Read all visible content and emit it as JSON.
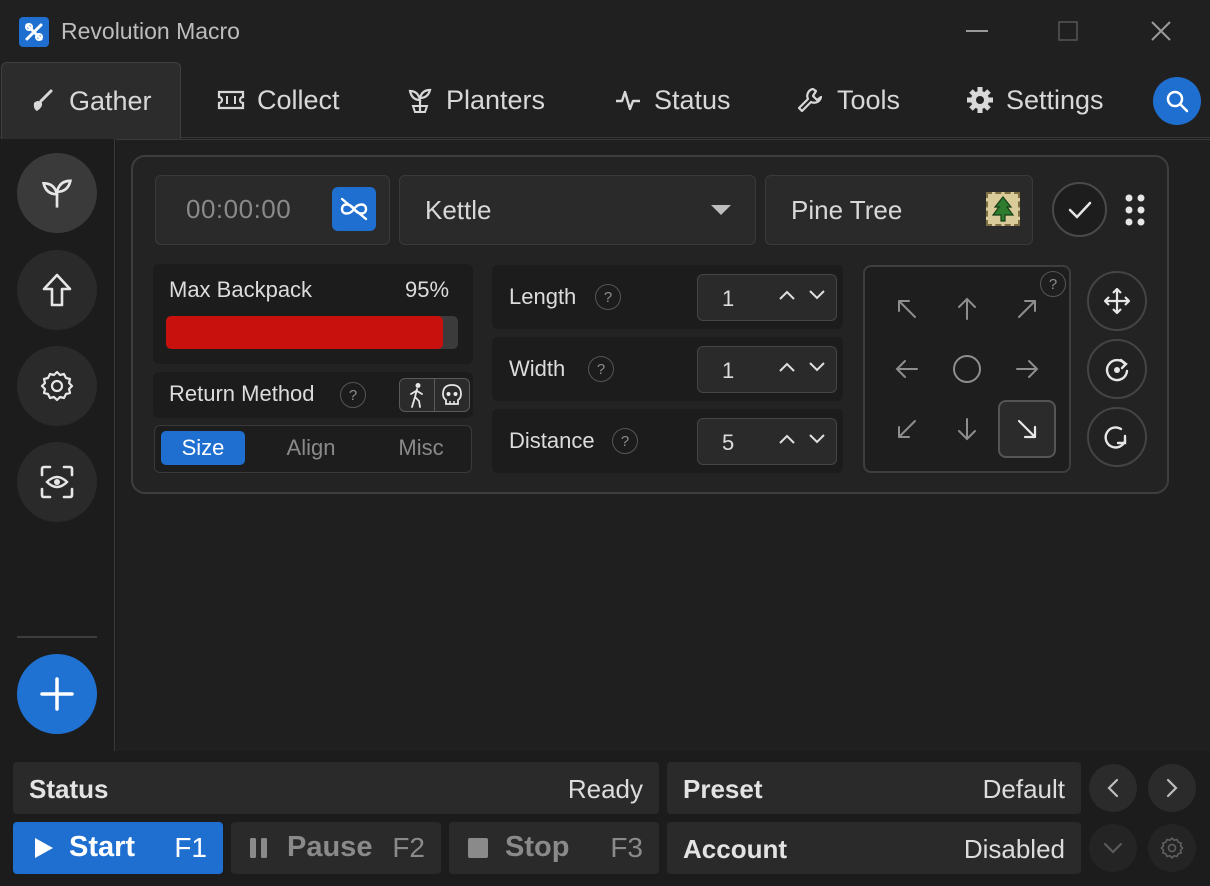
{
  "window": {
    "title": "Revolution Macro"
  },
  "tabs": [
    {
      "label": "Gather",
      "icon": "shovel-icon",
      "active": true
    },
    {
      "label": "Collect",
      "icon": "ticket-icon"
    },
    {
      "label": "Planters",
      "icon": "sprout-icon"
    },
    {
      "label": "Status",
      "icon": "activity-icon"
    },
    {
      "label": "Tools",
      "icon": "wrench-icon"
    },
    {
      "label": "Settings",
      "icon": "gear-icon"
    }
  ],
  "sidebar": {
    "items": [
      {
        "icon": "sprout-icon",
        "active": true
      },
      {
        "icon": "arrow-up-icon"
      },
      {
        "icon": "gear-icon"
      },
      {
        "icon": "eye-scan-icon"
      }
    ],
    "add_icon": "plus-icon"
  },
  "gather": {
    "timer": "00:00:00",
    "field": "Kettle",
    "pattern": "Pine Tree",
    "backpack": {
      "label": "Max Backpack",
      "value_text": "95%",
      "value": 0.95
    },
    "return_method": {
      "label": "Return Method",
      "help": "?"
    },
    "segments": [
      "Size",
      "Align",
      "Misc"
    ],
    "active_segment": "Size",
    "params": [
      {
        "label": "Length",
        "help": "?",
        "value": "1"
      },
      {
        "label": "Width",
        "help": "?",
        "value": "1"
      },
      {
        "label": "Distance",
        "help": "?",
        "value": "5"
      }
    ],
    "direction_help": "?",
    "direction_selected": "down-right"
  },
  "status_bar": {
    "status_label": "Status",
    "status_value": "Ready",
    "preset_label": "Preset",
    "preset_value": "Default",
    "account_label": "Account",
    "account_value": "Disabled"
  },
  "controls": {
    "start_label": "Start",
    "start_key": "F1",
    "pause_label": "Pause",
    "pause_key": "F2",
    "stop_label": "Stop",
    "stop_key": "F3"
  },
  "colors": {
    "accent": "#1f6fd1",
    "backpack_fill": "#c8100c"
  }
}
